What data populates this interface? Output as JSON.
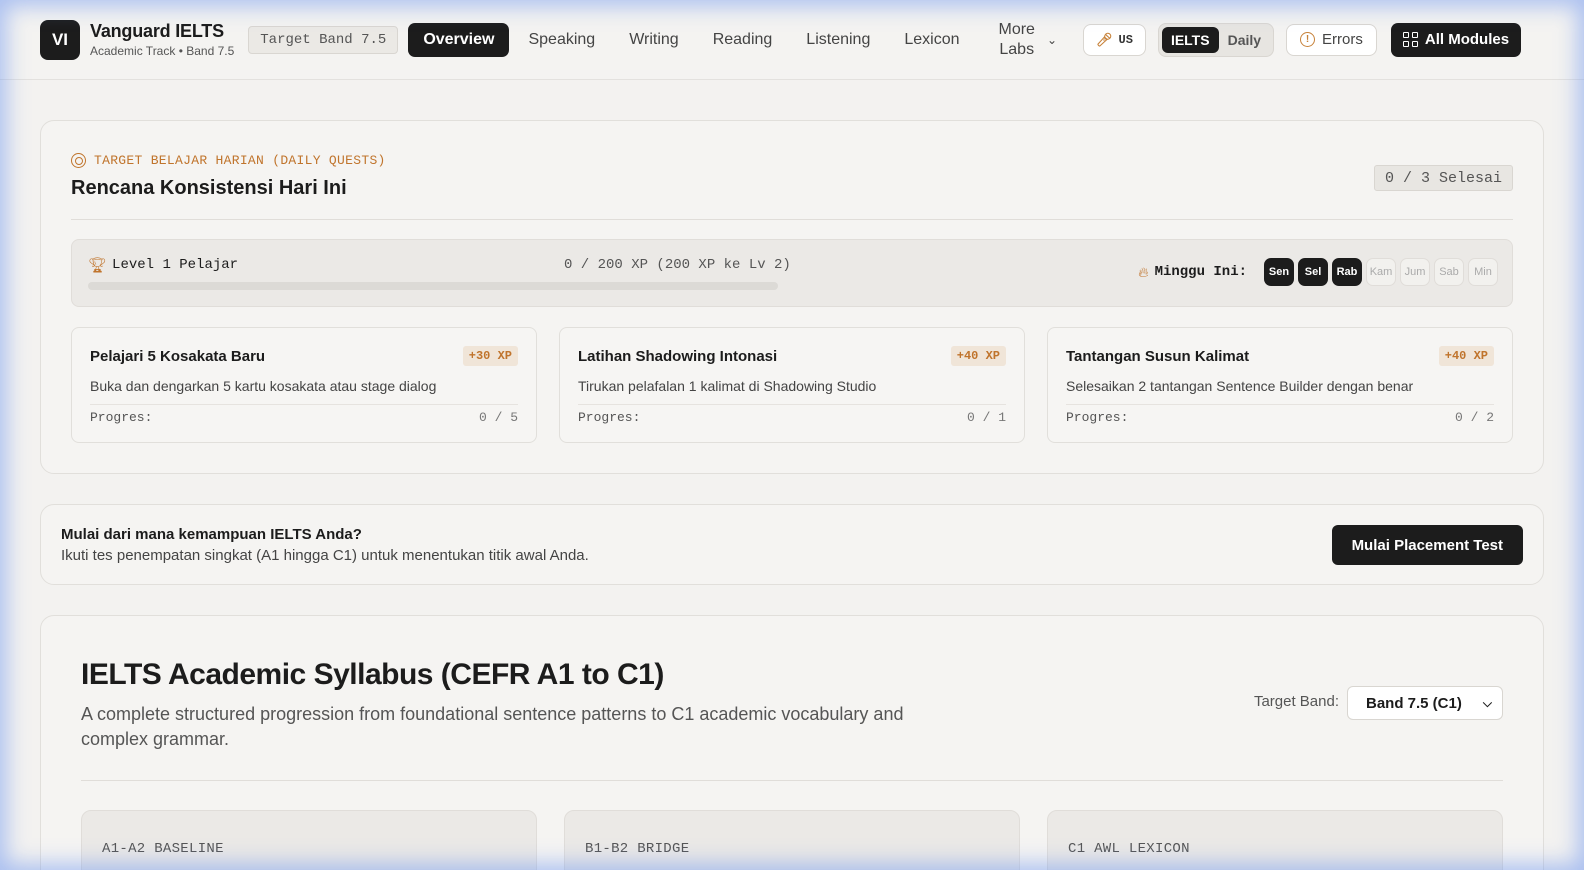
{
  "header": {
    "logo": "VI",
    "brand_name": "Vanguard IELTS",
    "brand_sub": "Academic Track • Band 7.5",
    "target_pill": "Target Band 7.5",
    "nav": [
      "Overview",
      "Speaking",
      "Writing",
      "Reading",
      "Listening",
      "Lexicon"
    ],
    "active_nav": "Overview",
    "more_line1": "More",
    "more_line2": "Labs",
    "accent": "US",
    "mode_toggle": [
      "IELTS",
      "Daily"
    ],
    "mode_active": "IELTS",
    "errors_label": "Errors",
    "modules_label": "All Modules"
  },
  "quests": {
    "eyebrow": "TARGET BELAJAR HARIAN (DAILY QUESTS)",
    "title": "Rencana Konsistensi Hari Ini",
    "done_count": "0 / 3 Selesai",
    "level_label": "Level 1 Pelajar",
    "xp_text": "0 / 200 XP (200 XP ke Lv 2)",
    "xp_progress": 0,
    "week_label": "Minggu Ini:",
    "days": [
      {
        "label": "Sen",
        "done": true
      },
      {
        "label": "Sel",
        "done": true
      },
      {
        "label": "Rab",
        "done": true
      },
      {
        "label": "Kam",
        "done": false
      },
      {
        "label": "Jum",
        "done": false
      },
      {
        "label": "Sab",
        "done": false
      },
      {
        "label": "Min",
        "done": false
      }
    ],
    "items": [
      {
        "title": "Pelajari 5 Kosakata Baru",
        "xp": "+30 XP",
        "desc": "Buka dan dengarkan 5 kartu kosakata atau stage dialog",
        "progress_label": "Progres:",
        "progress": "0 / 5"
      },
      {
        "title": "Latihan Shadowing Intonasi",
        "xp": "+40 XP",
        "desc": "Tirukan pelafalan 1 kalimat di Shadowing Studio",
        "progress_label": "Progres:",
        "progress": "0 / 1"
      },
      {
        "title": "Tantangan Susun Kalimat",
        "xp": "+40 XP",
        "desc": "Selesaikan 2 tantangan Sentence Builder dengan benar",
        "progress_label": "Progres:",
        "progress": "0 / 2"
      }
    ]
  },
  "placement": {
    "title": "Mulai dari mana kemampuan IELTS Anda?",
    "subtitle": "Ikuti tes penempatan singkat (A1 hingga C1) untuk menentukan titik awal Anda.",
    "button": "Mulai Placement Test"
  },
  "syllabus": {
    "title": "IELTS Academic Syllabus (CEFR A1 to C1)",
    "description": "A complete structured progression from foundational sentence patterns to C1 academic vocabulary and complex grammar.",
    "band_label": "Target Band:",
    "band_value": "Band 7.5 (C1)",
    "tracks": [
      "A1-A2 BASELINE",
      "B1-B2 BRIDGE",
      "C1 AWL LEXICON"
    ]
  },
  "colors": {
    "accent": "#c0742c",
    "dark": "#1c1c1c",
    "background": "#f3f2f0"
  }
}
